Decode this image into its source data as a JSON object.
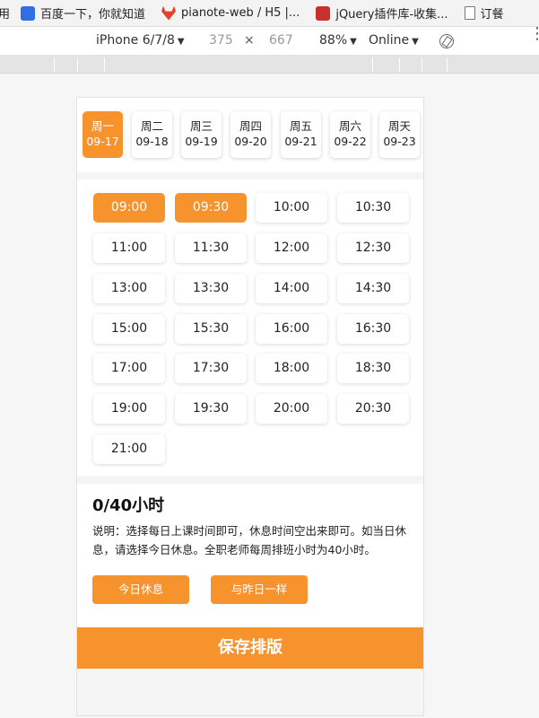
{
  "browser": {
    "bookmarks": [
      {
        "label": "用",
        "icon": "none"
      },
      {
        "label": "百度一下，你就知道",
        "icon": "baidu-icon"
      },
      {
        "label": "pianote-web / H5 |...",
        "icon": "gitlab-icon"
      },
      {
        "label": "jQuery插件库-收集...",
        "icon": "jquery-icon"
      },
      {
        "label": "订餐",
        "icon": "document-icon"
      }
    ]
  },
  "devtools": {
    "device": "iPhone 6/7/8",
    "width": "375",
    "times_sign": "×",
    "height": "667",
    "zoom": "88%",
    "network": "Online",
    "caret": "▼",
    "more": "⋮"
  },
  "app": {
    "days": [
      {
        "weekday": "周一",
        "date": "09-17",
        "active": true
      },
      {
        "weekday": "周二",
        "date": "09-18",
        "active": false
      },
      {
        "weekday": "周三",
        "date": "09-19",
        "active": false
      },
      {
        "weekday": "周四",
        "date": "09-20",
        "active": false
      },
      {
        "weekday": "周五",
        "date": "09-21",
        "active": false
      },
      {
        "weekday": "周六",
        "date": "09-22",
        "active": false
      },
      {
        "weekday": "周天",
        "date": "09-23",
        "active": false
      }
    ],
    "times": [
      {
        "label": "09:00",
        "active": true
      },
      {
        "label": "09:30",
        "active": true
      },
      {
        "label": "10:00",
        "active": false
      },
      {
        "label": "10:30",
        "active": false
      },
      {
        "label": "11:00",
        "active": false
      },
      {
        "label": "11:30",
        "active": false
      },
      {
        "label": "12:00",
        "active": false
      },
      {
        "label": "12:30",
        "active": false
      },
      {
        "label": "13:00",
        "active": false
      },
      {
        "label": "13:30",
        "active": false
      },
      {
        "label": "14:00",
        "active": false
      },
      {
        "label": "14:30",
        "active": false
      },
      {
        "label": "15:00",
        "active": false
      },
      {
        "label": "15:30",
        "active": false
      },
      {
        "label": "16:00",
        "active": false
      },
      {
        "label": "16:30",
        "active": false
      },
      {
        "label": "17:00",
        "active": false
      },
      {
        "label": "17:30",
        "active": false
      },
      {
        "label": "18:00",
        "active": false
      },
      {
        "label": "18:30",
        "active": false
      },
      {
        "label": "19:00",
        "active": false
      },
      {
        "label": "19:30",
        "active": false
      },
      {
        "label": "20:00",
        "active": false
      },
      {
        "label": "20:30",
        "active": false
      },
      {
        "label": "21:00",
        "active": false
      }
    ],
    "hours": "0/40小时",
    "description": "说明：选择每日上课时间即可，休息时间空出来即可。如当日休息，请选择今日休息。全职老师每周排班小时为40小时。",
    "rest_today": "今日休息",
    "same_as_yesterday": "与昨日一样",
    "save": "保存排版"
  },
  "colors": {
    "accent": "#f7932d"
  }
}
